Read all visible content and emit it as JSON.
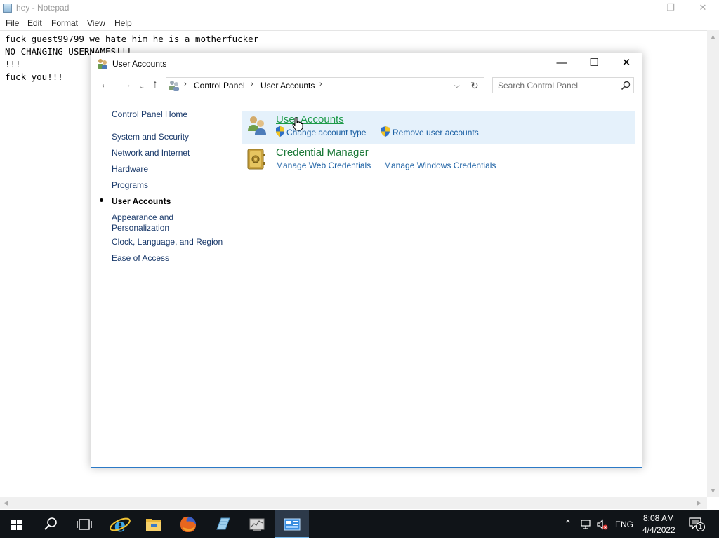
{
  "notepad": {
    "title": "hey - Notepad",
    "menu": [
      "File",
      "Edit",
      "Format",
      "View",
      "Help"
    ],
    "lines": [
      "fuck guest99799 we hate him he is a motherfucker",
      "NO CHANGING USERNAMES!!!",
      "!!!",
      "fuck you!!!"
    ]
  },
  "control_panel": {
    "title": "User Accounts",
    "address": {
      "segments": [
        "Control Panel",
        "User Accounts"
      ]
    },
    "search": {
      "placeholder": "Search Control Panel"
    },
    "left_nav": {
      "home": "Control Panel Home",
      "items": [
        "System and Security",
        "Network and Internet",
        "Hardware",
        "Programs",
        "User Accounts",
        "Appearance and Personalization",
        "Clock, Language, and Region",
        "Ease of Access"
      ],
      "active": "User Accounts"
    },
    "categories": [
      {
        "heading": "User Accounts",
        "links": [
          "Change account type",
          "Remove user accounts"
        ]
      },
      {
        "heading": "Credential Manager",
        "links": [
          "Manage Web Credentials",
          "Manage Windows Credentials"
        ]
      }
    ]
  },
  "taskbar": {
    "language": "ENG",
    "time": "8:08 AM",
    "date": "4/4/2022",
    "notification_count": "1"
  },
  "colors": {
    "accent": "#2b79c6",
    "link": "#1a5fa3",
    "category_heading": "#1d9a48",
    "hover_bg": "#e5f1fb",
    "taskbar": "#101418"
  }
}
